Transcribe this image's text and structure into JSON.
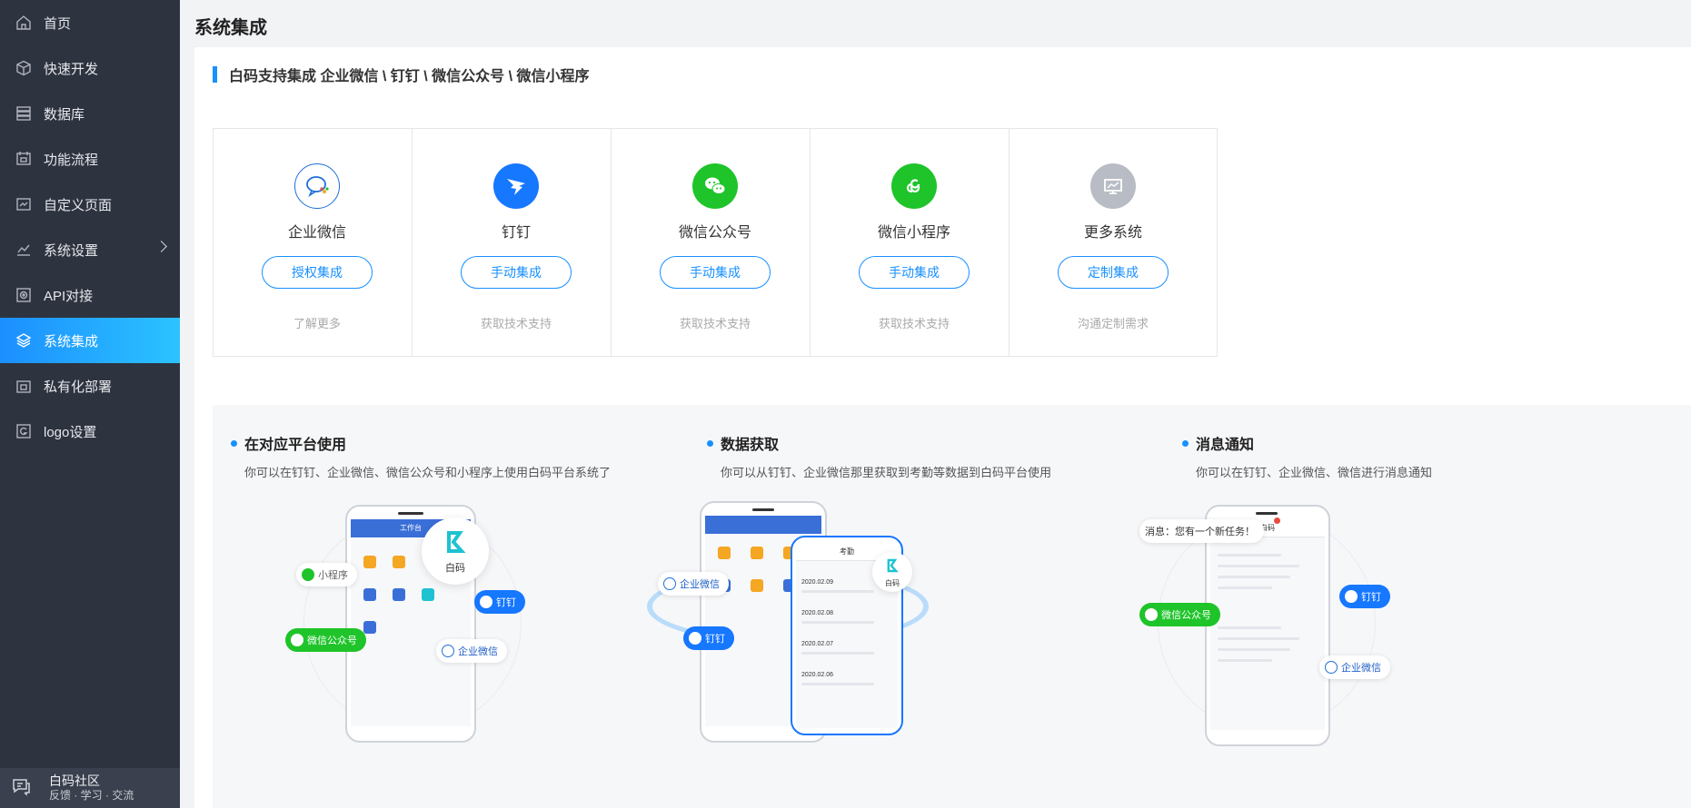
{
  "sidebar": {
    "items": [
      {
        "label": "首页",
        "icon": "home-icon"
      },
      {
        "label": "快速开发",
        "icon": "cube-icon"
      },
      {
        "label": "数据库",
        "icon": "database-icon"
      },
      {
        "label": "功能流程",
        "icon": "flow-icon"
      },
      {
        "label": "自定义页面",
        "icon": "page-icon"
      },
      {
        "label": "系统设置",
        "icon": "chart-icon"
      },
      {
        "label": "API对接",
        "icon": "api-icon"
      },
      {
        "label": "系统集成",
        "icon": "layers-icon"
      },
      {
        "label": "私有化部署",
        "icon": "lock-icon"
      },
      {
        "label": "logo设置",
        "icon": "logo-icon"
      }
    ],
    "active_index": 7,
    "community": {
      "title": "白码社区",
      "subtitle": "反馈 · 学习 · 交流"
    }
  },
  "page": {
    "title": "系统集成",
    "section_title": "白码支持集成 企业微信 \\ 钉钉 \\ 微信公众号 \\ 微信小程序"
  },
  "cards": [
    {
      "name": "企业微信",
      "button": "授权集成",
      "sub": "了解更多",
      "color": "#ffffff"
    },
    {
      "name": "钉钉",
      "button": "手动集成",
      "sub": "获取技术支持",
      "color": "#1677ff"
    },
    {
      "name": "微信公众号",
      "button": "手动集成",
      "sub": "获取技术支持",
      "color": "#1ec429"
    },
    {
      "name": "微信小程序",
      "button": "手动集成",
      "sub": "获取技术支持",
      "color": "#1ec429"
    },
    {
      "name": "更多系统",
      "button": "定制集成",
      "sub": "沟通定制需求",
      "color": "#b8bcc4"
    }
  ],
  "features": [
    {
      "title": "在对应平台使用",
      "desc": "你可以在钉钉、企业微信、微信公众号和小程序上使用白码平台系统了"
    },
    {
      "title": "数据获取",
      "desc": "你可以从钉钉、企业微信那里获取到考勤等数据到白码平台使用"
    },
    {
      "title": "消息通知",
      "desc": "你可以在钉钉、企业微信、微信进行消息通知"
    }
  ],
  "illustration": {
    "workbench": "工作台",
    "baima": "白码",
    "mini_program": "小程序",
    "wechat_official": "微信公众号",
    "dingtalk": "钉钉",
    "wework": "企业微信",
    "message": "消息：您有一个新任务！",
    "attendance": "考勤",
    "dates": [
      "2020.02.09",
      "2020.02.08",
      "2020.02.07",
      "2020.02.06"
    ]
  },
  "colors": {
    "accent": "#1890ff",
    "sidebar_bg": "#2e3340",
    "dingtalk": "#1677ff",
    "wechat": "#1ec429"
  }
}
